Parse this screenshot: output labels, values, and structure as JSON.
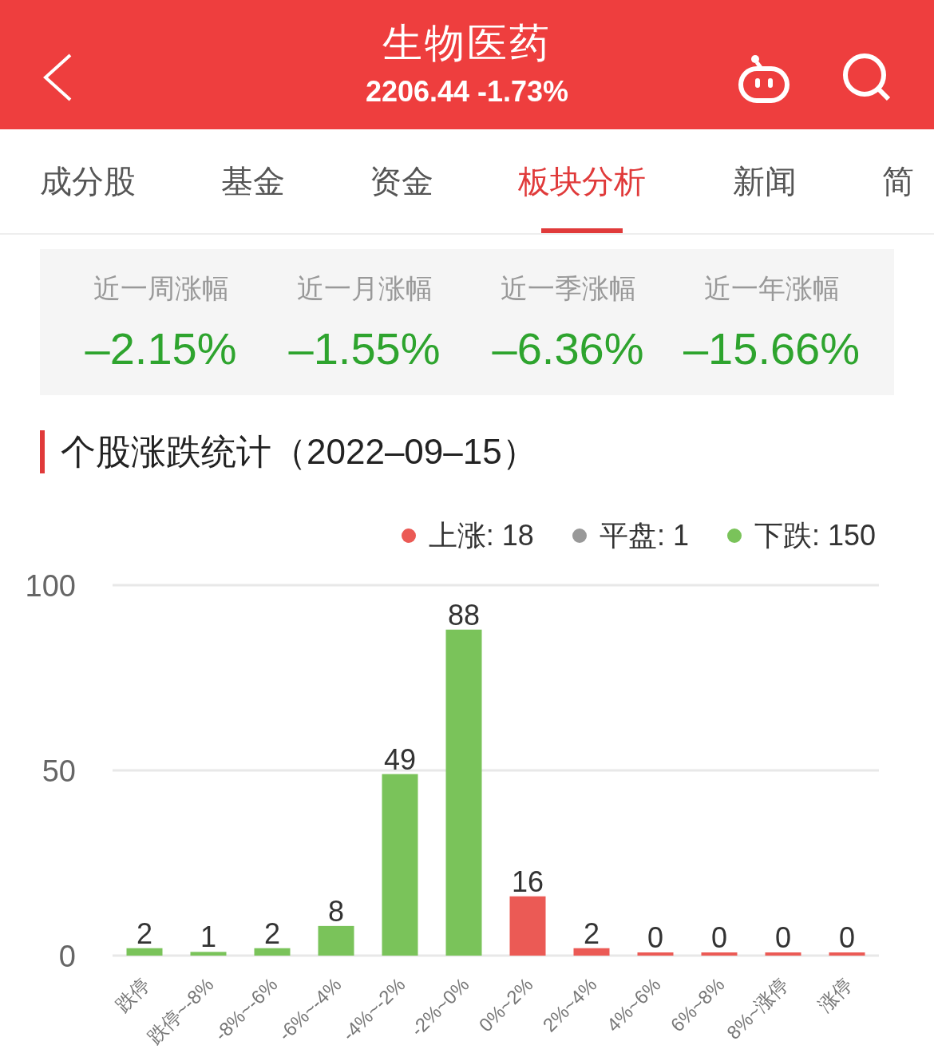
{
  "header": {
    "title": "生物医药",
    "quote": "2206.44 -1.73%"
  },
  "tabs": [
    {
      "label": "成分股",
      "selected": false
    },
    {
      "label": "基金",
      "selected": false
    },
    {
      "label": "资金",
      "selected": false
    },
    {
      "label": "板块分析",
      "selected": true
    },
    {
      "label": "新闻",
      "selected": false
    },
    {
      "label": "简",
      "selected": false
    }
  ],
  "returns": [
    {
      "label": "近一周涨幅",
      "value": "–2.15%"
    },
    {
      "label": "近一月涨幅",
      "value": "–1.55%"
    },
    {
      "label": "近一季涨幅",
      "value": "–6.36%"
    },
    {
      "label": "近一年涨幅",
      "value": "–15.66%"
    }
  ],
  "section_title": "个股涨跌统计（2022–09–15）",
  "legend": [
    {
      "label": "上涨: 18",
      "color": "#eb5a55"
    },
    {
      "label": "平盘: 1",
      "color": "#999999"
    },
    {
      "label": "下跌: 150",
      "color": "#7ac35a"
    }
  ],
  "chart_data": {
    "type": "bar",
    "data_labels": true,
    "ylim": [
      0,
      100
    ],
    "yticks": [
      0,
      50,
      100
    ],
    "categories": [
      "跌停",
      "跌停~-8%",
      "-8%~-6%",
      "-6%~-4%",
      "-4%~-2%",
      "-2%~0%",
      "0%~2%",
      "2%~4%",
      "4%~6%",
      "6%~8%",
      "8%~涨停",
      "涨停"
    ],
    "series": [
      {
        "color": "#7ac35a",
        "values": [
          2,
          1,
          2,
          8,
          49,
          88,
          null,
          null,
          null,
          null,
          null,
          null
        ]
      },
      {
        "color": "#eb5a55",
        "values": [
          null,
          null,
          null,
          null,
          null,
          null,
          16,
          2,
          0,
          0,
          0,
          0
        ]
      }
    ]
  }
}
